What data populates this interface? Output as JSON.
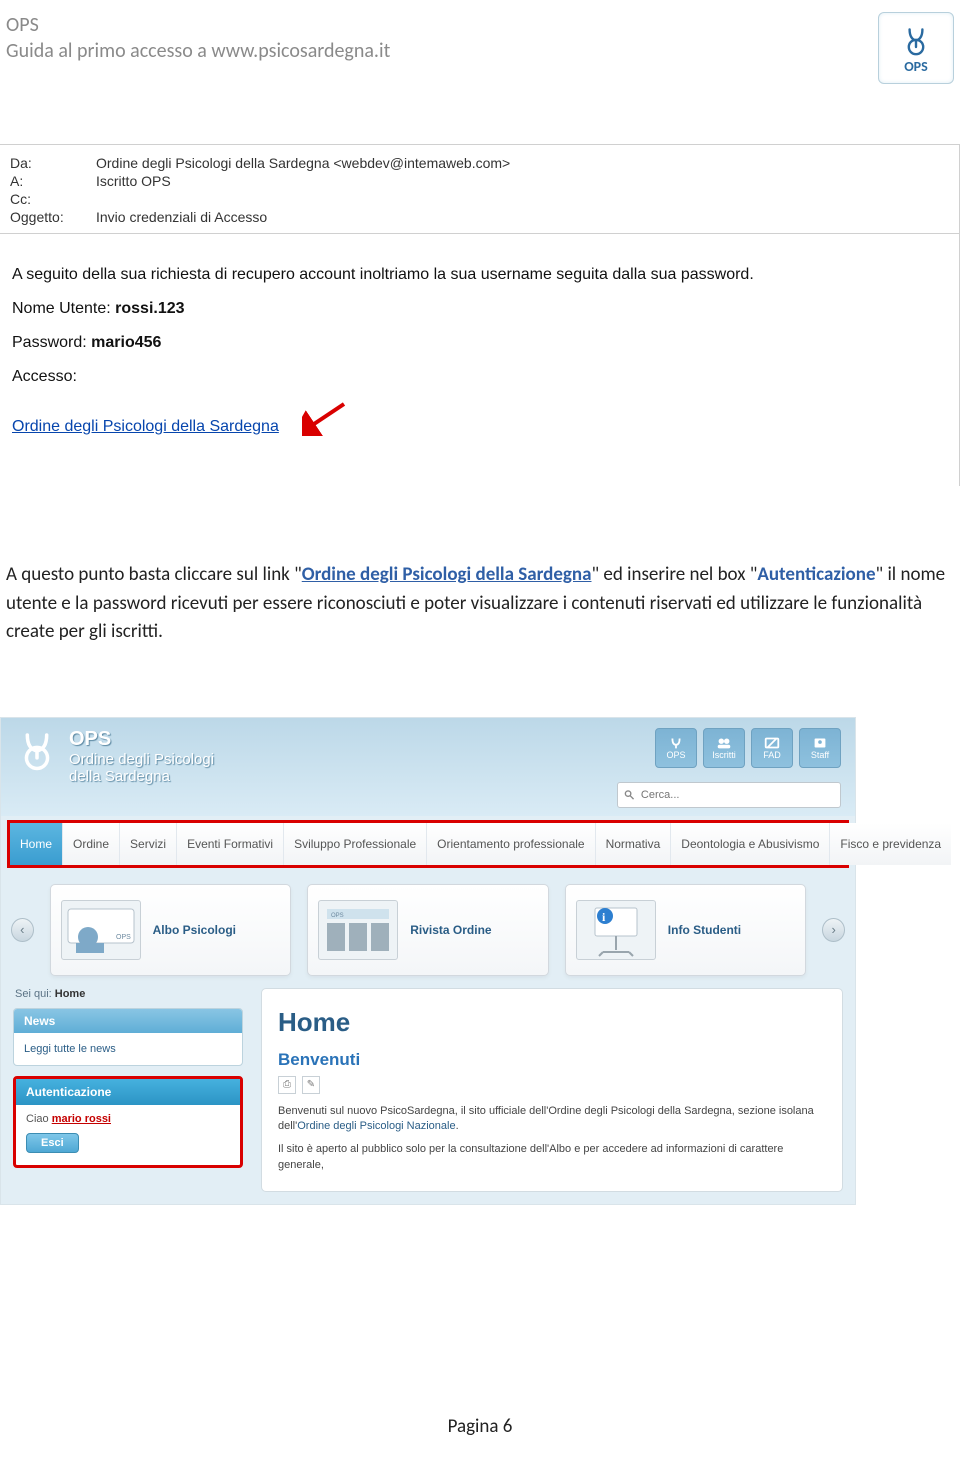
{
  "doc": {
    "header_line1": "OPS",
    "header_line2": "Guida  al primo accesso a www.psicosardegna.it",
    "logo_text": "OPS",
    "footer": "Pagina 6"
  },
  "email": {
    "from_label": "Da:",
    "from_value": "Ordine degli Psicologi della Sardegna <webdev@intemaweb.com>",
    "to_label": "A:",
    "to_value": "Iscritto OPS",
    "cc_label": "Cc:",
    "cc_value": "",
    "subject_label": "Oggetto:",
    "subject_value": "Invio credenziali di Accesso",
    "intro": "A seguito della sua richiesta di recupero account inoltriamo la sua username seguita dalla sua password.",
    "username_label": "Nome Utente: ",
    "username_value": "rossi.123",
    "password_label": "Password: ",
    "password_value": "mario456",
    "access_label": "Accesso:",
    "access_link": "Ordine degli Psicologi della Sardegna"
  },
  "instruction": {
    "p1a": "A questo punto basta cliccare sul link \"",
    "p1b_link": "Ordine degli Psicologi della Sardegna",
    "p1c": "\" ed inserire nel box \"",
    "p1d_auth": "Autenticazione",
    "p1e": "\" il nome utente e la password ricevuti per essere riconosciuti e poter visualizzare i contenuti riservati ed utilizzare le funzionalità create per gli iscritti."
  },
  "site": {
    "title_top": "OPS",
    "title_sub1": "Ordine degli Psicologi",
    "title_sub2": "della Sardegna",
    "squares": [
      "OPS",
      "Iscritti",
      "FAD",
      "Staff"
    ],
    "search_placeholder": "Cerca...",
    "nav": [
      "Home",
      "Ordine",
      "Servizi",
      "Eventi Formativi",
      "Sviluppo Professionale",
      "Orientamento professionale",
      "Normativa",
      "Deontologia e Abusivismo",
      "Fisco e previdenza"
    ],
    "cards": [
      "Albo Psicologi",
      "Rivista Ordine",
      "Info Studenti"
    ],
    "breadcrumb_prefix": "Sei qui: ",
    "breadcrumb_page": "Home",
    "news_head": "News",
    "news_link": "Leggi tutte le news",
    "auth_head": "Autenticazione",
    "auth_greet": "Ciao ",
    "auth_user": "mario rossi",
    "auth_logout": "Esci",
    "main_h1": "Home",
    "main_h2": "Benvenuti",
    "main_p1a": "Benvenuti sul nuovo PsicoSardegna, il sito ufficiale dell'Ordine degli Psicologi della Sardegna, sezione isolana dell'",
    "main_p1b_link": "Ordine degli Psicologi Nazionale",
    "main_p1c": ".",
    "main_p2": "Il sito è aperto al pubblico solo per la consultazione dell'Albo e per accedere ad informazioni di carattere generale,"
  }
}
